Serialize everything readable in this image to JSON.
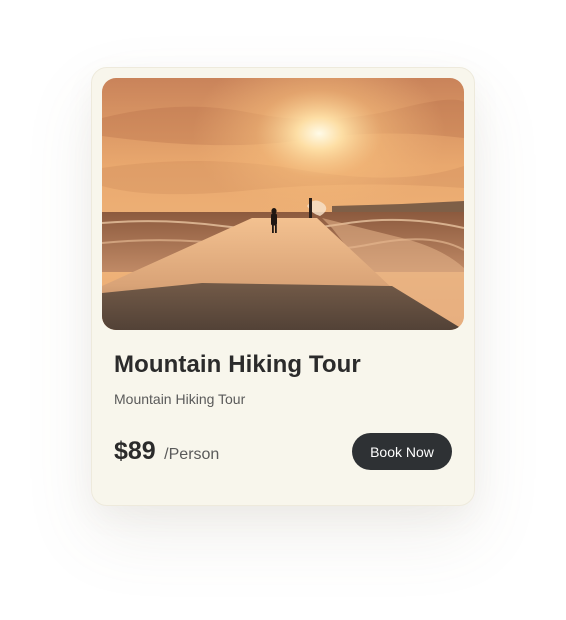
{
  "card": {
    "image_description_icon": "sunset-pier-photo",
    "title": "Mountain Hiking Tour",
    "subtitle": "Mountain Hiking Tour",
    "price": {
      "amount": "$89",
      "unit": "/Person"
    },
    "book_button_label": "Book Now"
  },
  "colors": {
    "card_background": "#f8f6ec",
    "button_background": "#2e3134",
    "button_text": "#ffffff",
    "title_text": "#2b2b2b",
    "muted_text": "#5a5a5a"
  }
}
